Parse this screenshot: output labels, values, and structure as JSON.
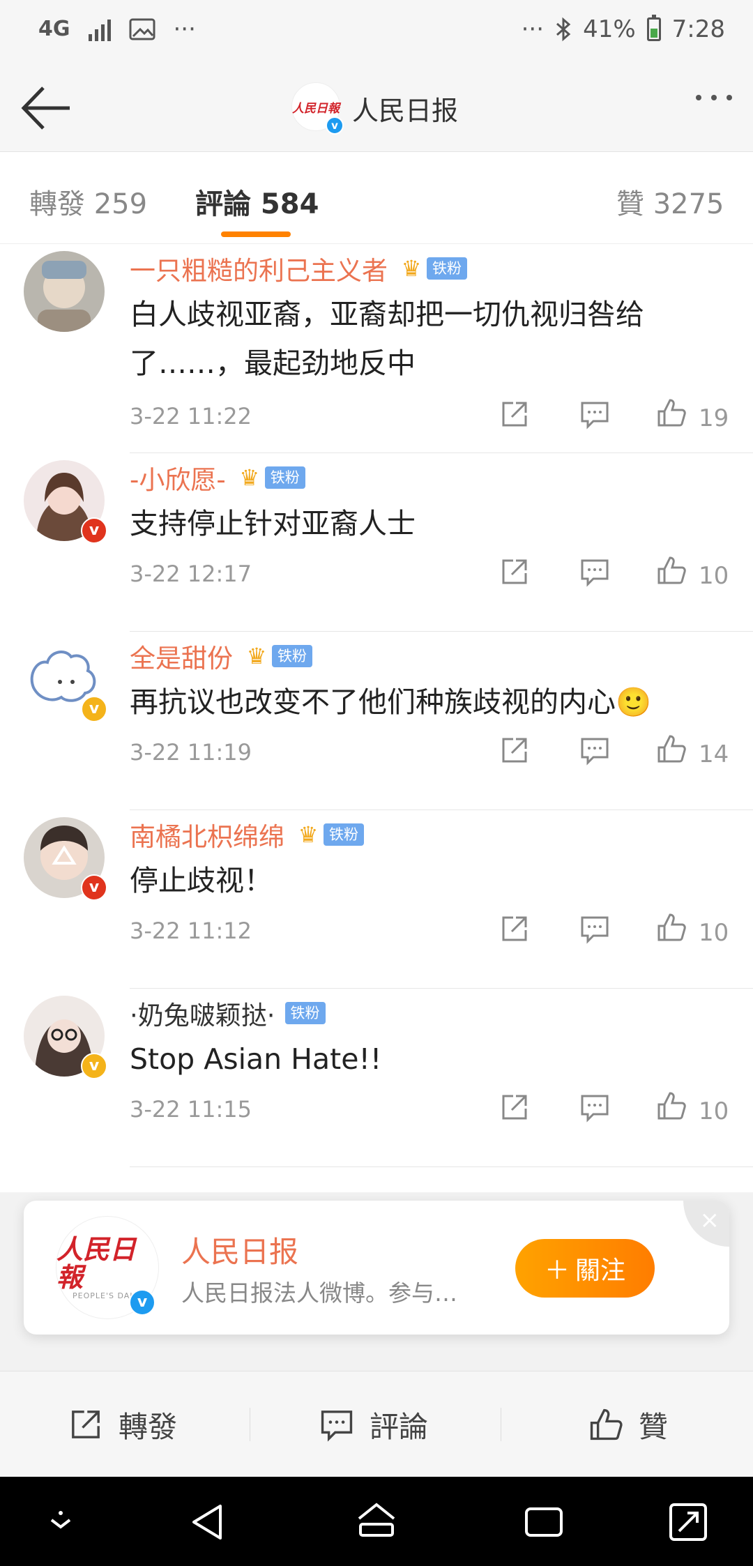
{
  "status_bar": {
    "network": "4G",
    "dots_left": "···",
    "dots_right": "···",
    "battery": "41%",
    "time": "7:28"
  },
  "header": {
    "title": "人民日报",
    "avatar_logo": "人民日報"
  },
  "tabs": [
    {
      "label": "轉發 259"
    },
    {
      "label": "評論 584"
    },
    {
      "label": "贊 3275"
    }
  ],
  "comments": [
    {
      "user": "一只粗糙的利己主义者",
      "badge": "铁粉",
      "text": "白人歧视亚裔，亚裔却把一切仇视归咎给了……，最起劲地反中",
      "time": "3-22 11:22",
      "likes": "19",
      "verify": ""
    },
    {
      "user": "-小欣愿-",
      "badge": "铁粉",
      "text": "支持停止针对亚裔人士",
      "time": "3-22 12:17",
      "likes": "10",
      "verify": "red"
    },
    {
      "user": "全是甜份",
      "badge": "铁粉",
      "text": "再抗议也改变不了他们种族歧视的内心🙂",
      "time": "3-22 11:19",
      "likes": "14",
      "verify": "gold"
    },
    {
      "user": "南橘北枳绵绵",
      "badge": "铁粉",
      "text": "停止歧视！",
      "time": "3-22 11:12",
      "likes": "10",
      "verify": "red"
    },
    {
      "user": "·奶兔啵颖挞·",
      "badge": "铁粉",
      "text": "Stop Asian Hate!!",
      "time": "3-22 11:15",
      "likes": "10",
      "verify": "gold"
    }
  ],
  "popup": {
    "name": "人民日报",
    "description": "人民日报法人微博。参与…",
    "follow_label": "關注",
    "avatar_logo": "人民日報",
    "avatar_sub": "PEOPLE'S DAILY"
  },
  "bottom_bar": {
    "repost": "轉發",
    "comment": "評論",
    "like": "贊"
  },
  "colors": {
    "accent": "#ff8200",
    "username": "#eb7350",
    "fan_badge": "#6ea8ee"
  }
}
